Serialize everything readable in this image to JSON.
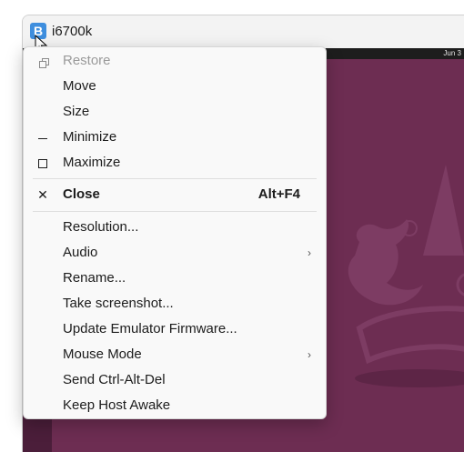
{
  "window": {
    "title": "i6700k",
    "app_icon_letter": "B"
  },
  "desktop": {
    "clock": "Jun 3"
  },
  "menu": {
    "items": [
      {
        "icon": "restore-icon",
        "label": "Restore",
        "disabled": true
      },
      {
        "icon": "",
        "label": "Move"
      },
      {
        "icon": "",
        "label": "Size"
      },
      {
        "icon": "minimize-icon",
        "label": "Minimize"
      },
      {
        "icon": "maximize-icon",
        "label": "Maximize"
      },
      {
        "icon": "close-icon",
        "label": "Close",
        "shortcut": "Alt+F4",
        "bold": true
      },
      {
        "icon": "",
        "label": "Resolution..."
      },
      {
        "icon": "",
        "label": "Audio",
        "submenu": true
      },
      {
        "icon": "",
        "label": "Rename..."
      },
      {
        "icon": "",
        "label": "Take screenshot..."
      },
      {
        "icon": "",
        "label": "Update Emulator Firmware..."
      },
      {
        "icon": "",
        "label": "Mouse Mode",
        "submenu": true
      },
      {
        "icon": "",
        "label": "Send Ctrl-Alt-Del"
      },
      {
        "icon": "",
        "label": "Keep Host Awake"
      }
    ]
  },
  "colors": {
    "desktop_bg": "#6d2d52",
    "app_icon": "#3e8ede",
    "menu_bg": "#f9f9f9"
  }
}
